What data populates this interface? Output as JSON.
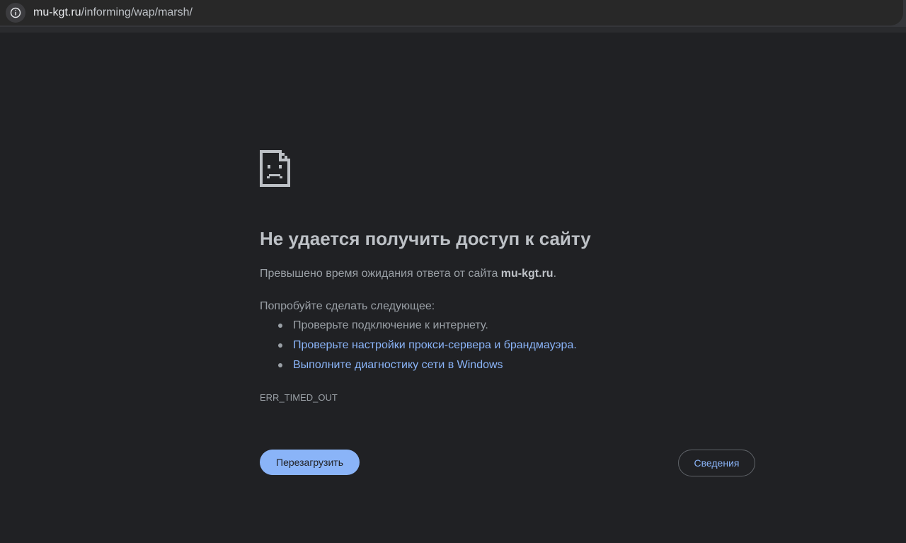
{
  "address_bar": {
    "url_host": "mu-kgt.ru",
    "url_path": "/informing/wap/marsh/",
    "icon": "info-icon"
  },
  "error_page": {
    "icon": "sad-page-icon",
    "title": "Не удается получить доступ к сайту",
    "description_prefix": "Превышено время ожидания ответа от сайта ",
    "description_host": "mu-kgt.ru",
    "description_suffix": ".",
    "suggestions_heading": "Попробуйте сделать следующее:",
    "suggestions": [
      {
        "text": "Проверьте подключение к интернету.",
        "is_link": false
      },
      {
        "text": "Проверьте настройки прокси-сервера и брандмауэра.",
        "is_link": true
      },
      {
        "text": "Выполните диагностику сети в Windows",
        "is_link": true
      }
    ],
    "error_code": "ERR_TIMED_OUT",
    "reload_label": "Перезагрузить",
    "details_label": "Сведения"
  },
  "colors": {
    "background": "#202124",
    "link": "#8ab4f8",
    "text": "#9aa0a6",
    "title": "#bdc1c6"
  }
}
